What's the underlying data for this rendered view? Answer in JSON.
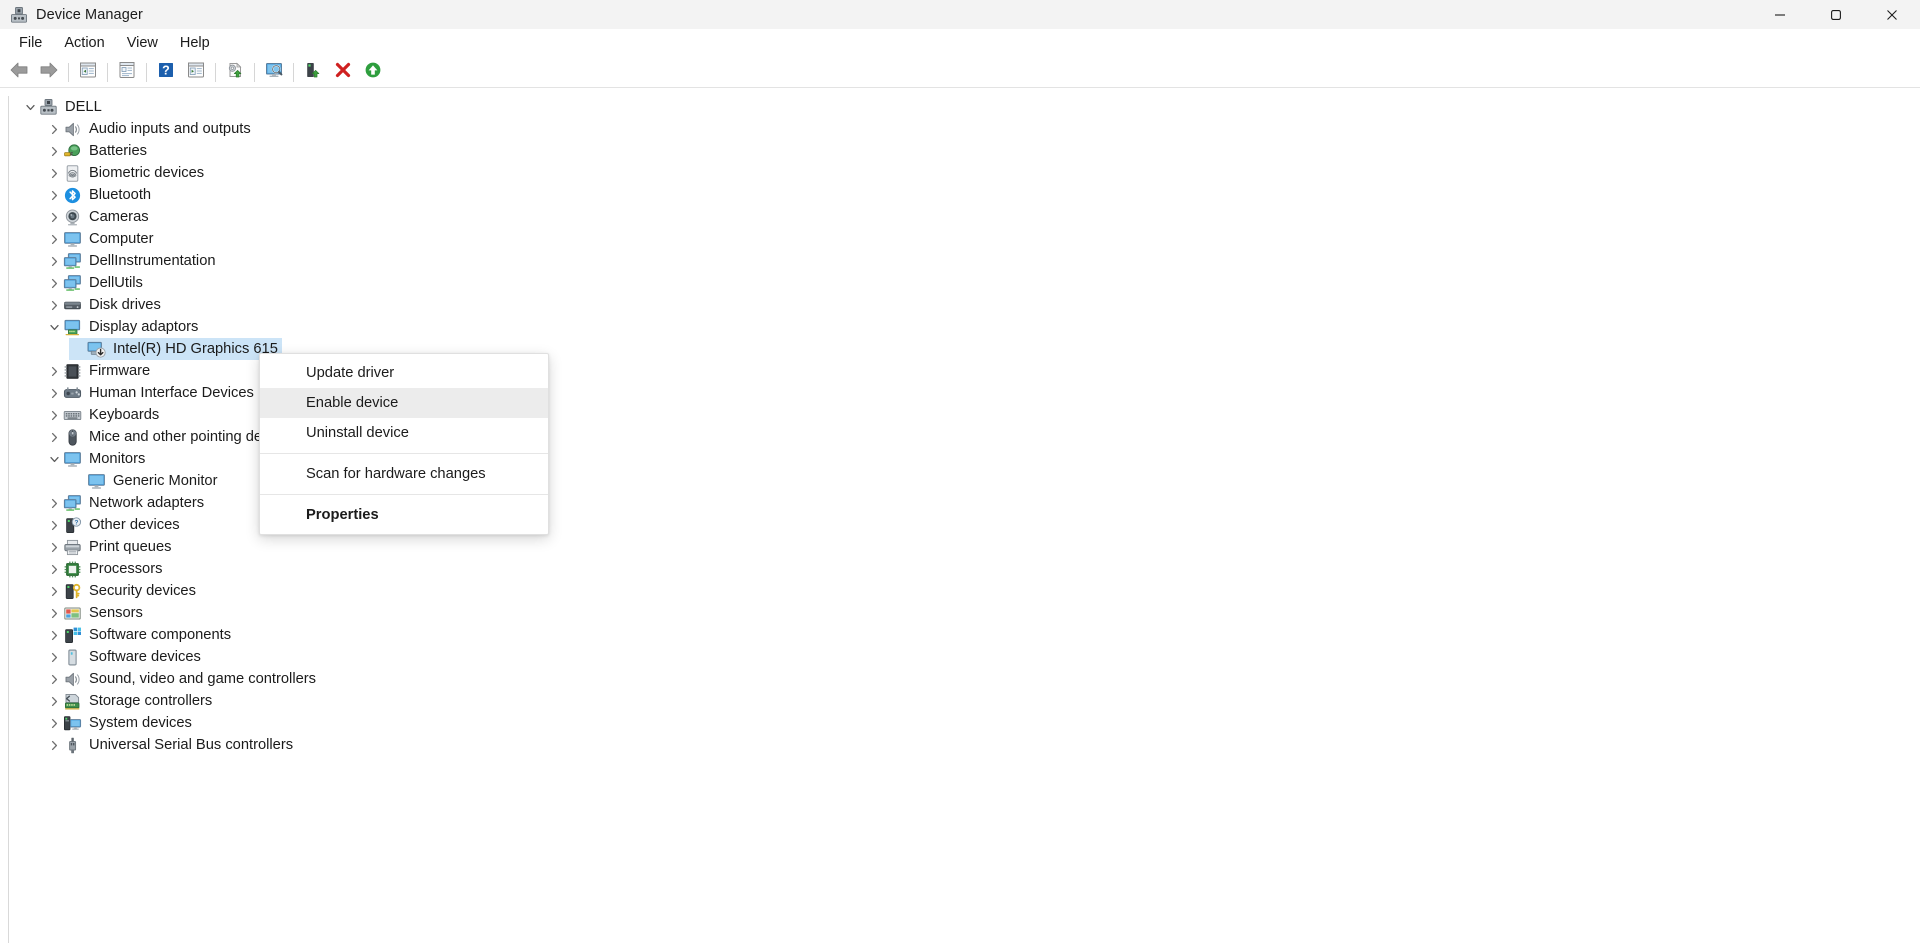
{
  "window": {
    "title": "Device Manager",
    "icon": "device-manager-icon",
    "controls": [
      {
        "name": "minimize-button",
        "glyph": "minimize"
      },
      {
        "name": "maximize-button",
        "glyph": "maximize"
      },
      {
        "name": "close-button",
        "glyph": "close"
      }
    ]
  },
  "menubar": {
    "items": [
      {
        "label": "File",
        "name": "menu-file"
      },
      {
        "label": "Action",
        "name": "menu-action"
      },
      {
        "label": "View",
        "name": "menu-view"
      },
      {
        "label": "Help",
        "name": "menu-help"
      }
    ]
  },
  "toolbar": {
    "buttons": [
      {
        "name": "back-button",
        "icon": "back-arrow-icon",
        "tooltip": "Back"
      },
      {
        "name": "forward-button",
        "icon": "forward-arrow-icon",
        "tooltip": "Forward"
      },
      {
        "name": "show-hide-console-tree-button",
        "icon": "console-tree-icon",
        "tooltip": "Show/Hide Console Tree"
      },
      {
        "name": "properties-button",
        "icon": "properties-icon",
        "tooltip": "Properties"
      },
      {
        "name": "help-button",
        "icon": "help-question-icon",
        "tooltip": "Help"
      },
      {
        "name": "show-hide-action-pane-button",
        "icon": "action-pane-icon",
        "tooltip": "Show/Hide Action Pane"
      },
      {
        "name": "update-driver-button",
        "icon": "update-driver-icon",
        "tooltip": "Update driver"
      },
      {
        "name": "scan-for-hardware-changes-button",
        "icon": "scan-hardware-icon",
        "tooltip": "Scan for hardware changes"
      },
      {
        "name": "disable-device-button",
        "icon": "disable-device-icon",
        "tooltip": "Disable device"
      },
      {
        "name": "uninstall-device-button",
        "icon": "uninstall-device-icon",
        "tooltip": "Uninstall device"
      },
      {
        "name": "enable-device-button",
        "icon": "enable-device-icon",
        "tooltip": "Enable device"
      }
    ]
  },
  "tree": {
    "nodes": [
      {
        "label": "DELL",
        "depth": 0,
        "state": "expanded",
        "icon": "computer-root-icon",
        "selected": false
      },
      {
        "label": "Audio inputs and outputs",
        "depth": 1,
        "state": "collapsed",
        "icon": "speaker-icon",
        "selected": false
      },
      {
        "label": "Batteries",
        "depth": 1,
        "state": "collapsed",
        "icon": "battery-icon",
        "selected": false
      },
      {
        "label": "Biometric devices",
        "depth": 1,
        "state": "collapsed",
        "icon": "fingerprint-icon",
        "selected": false
      },
      {
        "label": "Bluetooth",
        "depth": 1,
        "state": "collapsed",
        "icon": "bluetooth-icon",
        "selected": false
      },
      {
        "label": "Cameras",
        "depth": 1,
        "state": "collapsed",
        "icon": "camera-icon",
        "selected": false
      },
      {
        "label": "Computer",
        "depth": 1,
        "state": "collapsed",
        "icon": "monitor-icon",
        "selected": false
      },
      {
        "label": "DellInstrumentation",
        "depth": 1,
        "state": "collapsed",
        "icon": "network-monitors-icon",
        "selected": false
      },
      {
        "label": "DellUtils",
        "depth": 1,
        "state": "collapsed",
        "icon": "network-monitors-icon",
        "selected": false
      },
      {
        "label": "Disk drives",
        "depth": 1,
        "state": "collapsed",
        "icon": "disk-drive-icon",
        "selected": false
      },
      {
        "label": "Display adaptors",
        "depth": 1,
        "state": "expanded",
        "icon": "display-adapter-icon",
        "selected": false
      },
      {
        "label": "Intel(R) HD Graphics 615",
        "depth": 2,
        "state": "leaf",
        "icon": "display-adapter-disabled-icon",
        "selected": true
      },
      {
        "label": "Firmware",
        "depth": 1,
        "state": "collapsed",
        "icon": "chip-icon",
        "selected": false
      },
      {
        "label": "Human Interface Devices",
        "depth": 1,
        "state": "collapsed",
        "icon": "hid-icon",
        "selected": false
      },
      {
        "label": "Keyboards",
        "depth": 1,
        "state": "collapsed",
        "icon": "keyboard-icon",
        "selected": false
      },
      {
        "label": "Mice and other pointing de",
        "depth": 1,
        "state": "collapsed",
        "icon": "mouse-icon",
        "selected": false
      },
      {
        "label": "Monitors",
        "depth": 1,
        "state": "expanded",
        "icon": "monitor-icon",
        "selected": false
      },
      {
        "label": "Generic Monitor",
        "depth": 2,
        "state": "leaf",
        "icon": "monitor-icon",
        "selected": false
      },
      {
        "label": "Network adapters",
        "depth": 1,
        "state": "collapsed",
        "icon": "network-monitors-icon",
        "selected": false
      },
      {
        "label": "Other devices",
        "depth": 1,
        "state": "collapsed",
        "icon": "unknown-device-icon",
        "selected": false
      },
      {
        "label": "Print queues",
        "depth": 1,
        "state": "collapsed",
        "icon": "printer-icon",
        "selected": false
      },
      {
        "label": "Processors",
        "depth": 1,
        "state": "collapsed",
        "icon": "processor-icon",
        "selected": false
      },
      {
        "label": "Security devices",
        "depth": 1,
        "state": "collapsed",
        "icon": "security-key-icon",
        "selected": false
      },
      {
        "label": "Sensors",
        "depth": 1,
        "state": "collapsed",
        "icon": "sensor-icon",
        "selected": false
      },
      {
        "label": "Software components",
        "depth": 1,
        "state": "collapsed",
        "icon": "software-component-icon",
        "selected": false
      },
      {
        "label": "Software devices",
        "depth": 1,
        "state": "collapsed",
        "icon": "software-device-icon",
        "selected": false
      },
      {
        "label": "Sound, video and game controllers",
        "depth": 1,
        "state": "collapsed",
        "icon": "speaker-icon",
        "selected": false
      },
      {
        "label": "Storage controllers",
        "depth": 1,
        "state": "collapsed",
        "icon": "storage-controller-icon",
        "selected": false
      },
      {
        "label": "System devices",
        "depth": 1,
        "state": "collapsed",
        "icon": "system-device-icon",
        "selected": false
      },
      {
        "label": "Universal Serial Bus controllers",
        "depth": 1,
        "state": "collapsed",
        "icon": "usb-icon",
        "selected": false
      }
    ]
  },
  "context_menu": {
    "items": [
      {
        "label": "Update driver",
        "name": "context-update-driver",
        "hovered": false,
        "bold": false,
        "separator_after": false
      },
      {
        "label": "Enable device",
        "name": "context-enable-device",
        "hovered": true,
        "bold": false,
        "separator_after": false
      },
      {
        "label": "Uninstall device",
        "name": "context-uninstall-device",
        "hovered": false,
        "bold": false,
        "separator_after": true
      },
      {
        "label": "Scan for hardware changes",
        "name": "context-scan-for-hardware-changes",
        "hovered": false,
        "bold": false,
        "separator_after": true
      },
      {
        "label": "Properties",
        "name": "context-properties",
        "hovered": false,
        "bold": true,
        "separator_after": false
      }
    ]
  },
  "colors": {
    "selection": "#cce4f7",
    "titlebar": "#f3f3f3",
    "text": "#1b1b1b",
    "menu_hover": "#ececec",
    "close_hover": "#c42b1c"
  }
}
